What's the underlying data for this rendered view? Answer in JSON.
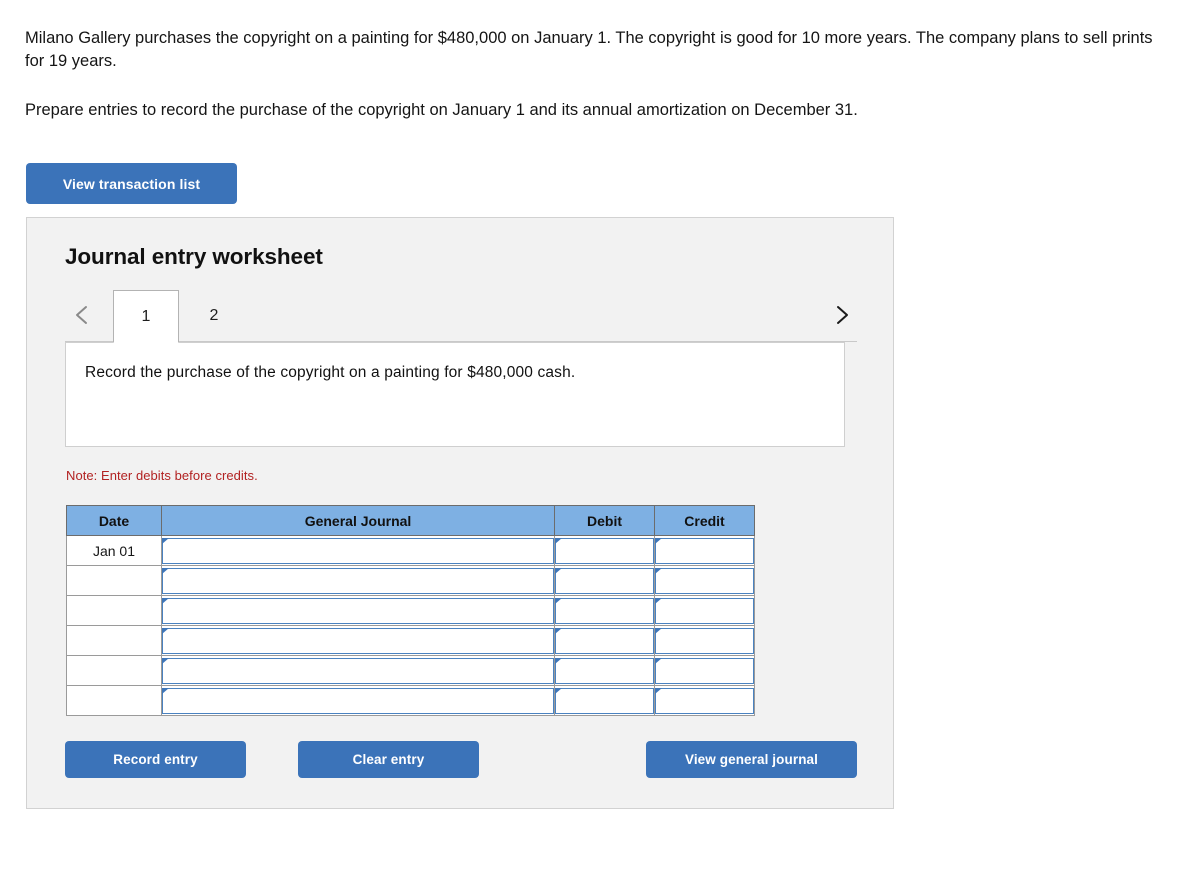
{
  "problem": {
    "paragraph_1": "Milano Gallery purchases the copyright on a painting for $480,000 on January 1. The copyright is good for 10 more years. The company plans to sell prints for 19 years.",
    "paragraph_2": "Prepare entries to record the purchase of the copyright on January 1 and its annual amortization on December 31."
  },
  "toolbar": {
    "view_transaction_list_label": "View transaction list"
  },
  "worksheet": {
    "title": "Journal entry worksheet",
    "tabs": [
      {
        "label": "1",
        "active": true
      },
      {
        "label": "2",
        "active": false
      }
    ],
    "nav": {
      "prev_icon": "chevron-left-icon",
      "next_icon": "chevron-right-icon"
    },
    "instruction": "Record the purchase of the copyright on a painting for $480,000 cash.",
    "note": "Note: Enter debits before credits.",
    "table": {
      "columns": [
        "Date",
        "General Journal",
        "Debit",
        "Credit"
      ],
      "rows": [
        {
          "date": "Jan 01",
          "general_journal": "",
          "debit": "",
          "credit": ""
        },
        {
          "date": "",
          "general_journal": "",
          "debit": "",
          "credit": ""
        },
        {
          "date": "",
          "general_journal": "",
          "debit": "",
          "credit": ""
        },
        {
          "date": "",
          "general_journal": "",
          "debit": "",
          "credit": ""
        },
        {
          "date": "",
          "general_journal": "",
          "debit": "",
          "credit": ""
        },
        {
          "date": "",
          "general_journal": "",
          "debit": "",
          "credit": ""
        }
      ]
    },
    "actions": {
      "record_entry_label": "Record entry",
      "clear_entry_label": "Clear entry",
      "view_general_journal_label": "View general journal"
    }
  },
  "colors": {
    "button_blue": "#3b73b9",
    "table_header_blue": "#7eb0e3",
    "cell_border_blue": "#4a82c0",
    "note_red": "#b22222",
    "panel_gray": "#f2f2f2"
  }
}
